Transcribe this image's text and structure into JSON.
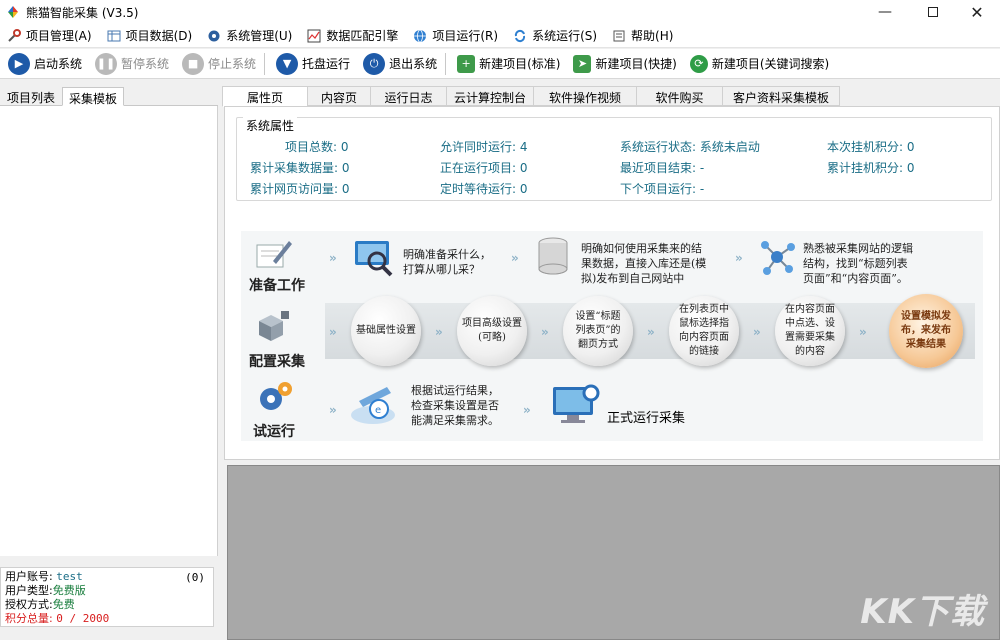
{
  "window": {
    "title": "熊猫智能采集  (V3.5)"
  },
  "menu": [
    {
      "label": "项目管理(A)",
      "icon": "wrench-icon"
    },
    {
      "label": "项目数据(D)",
      "icon": "table-icon"
    },
    {
      "label": "系统管理(U)",
      "icon": "gear-icon"
    },
    {
      "label": "数据匹配引擎",
      "icon": "chart-icon"
    },
    {
      "label": "项目运行(R)",
      "icon": "globe-icon"
    },
    {
      "label": "系统运行(S)",
      "icon": "sync-icon"
    },
    {
      "label": "帮助(H)",
      "icon": "help-icon"
    }
  ],
  "toolbar": {
    "start": "启动系统",
    "pause": "暂停系统",
    "stop": "停止系统",
    "tray": "托盘运行",
    "exit": "退出系统",
    "new_std": "新建项目(标准)",
    "new_quick": "新建项目(快捷)",
    "new_kw": "新建项目(关键词搜索)"
  },
  "left": {
    "tabs": [
      "项目列表",
      "采集模板"
    ],
    "account": {
      "user_label": "用户账号:",
      "user_value": "test",
      "count": "(0)",
      "type_label": "用户类型:",
      "type_value": "免费版",
      "auth_label": "授权方式:",
      "auth_value": "免费",
      "points_label": "积分总量:",
      "points_value": "0 / 2000"
    }
  },
  "tabs": [
    "属性页",
    "内容页",
    "运行日志",
    "云计算控制台",
    "软件操作视频",
    "软件购买",
    "客户资料采集模板"
  ],
  "props": {
    "group_title": "系统属性",
    "items": [
      {
        "k": "项目总数:",
        "v": "0"
      },
      {
        "k": "累计采集数据量:",
        "v": "0"
      },
      {
        "k": "累计网页访问量:",
        "v": "0"
      },
      {
        "k": "允许同时运行:",
        "v": "4"
      },
      {
        "k": "正在运行项目:",
        "v": "0"
      },
      {
        "k": "定时等待运行:",
        "v": "0"
      },
      {
        "k": "系统运行状态:",
        "v": "系统未启动"
      },
      {
        "k": "最近项目结束:",
        "v": "-"
      },
      {
        "k": "下个项目运行:",
        "v": "-"
      },
      {
        "k": "本次挂机积分:",
        "v": "0"
      },
      {
        "k": "累计挂机积分:",
        "v": "0"
      }
    ]
  },
  "flow": {
    "row1_label": "准备工作",
    "row1_steps": [
      "明确准备采什么，\n打算从哪儿采？",
      "明确如何使用采集来的结\n果数据，直接入库还是(模\n拟)发布到自己网站中",
      "熟悉被采集网站的逻辑\n结构，找到“标题列表\n页面”和“内容页面”。"
    ],
    "row2_label": "配置采集",
    "row2_steps": [
      "基础属性设置",
      "项目高级设置\n(可略)",
      "设置“标题\n列表页”的\n翻页方式",
      "在列表页中\n鼠标选择指\n向内容页面\n的链接",
      "在内容页面\n中点选、设\n置需要采集\n的内容",
      "设置模拟发\n布，来发布\n采集结果"
    ],
    "row3_label": "试运行",
    "row3_steps": [
      "根据试运行结果，\n检查采集设置是否\n能满足采集需求。",
      "正式运行采集"
    ]
  },
  "watermark": "KK下载"
}
